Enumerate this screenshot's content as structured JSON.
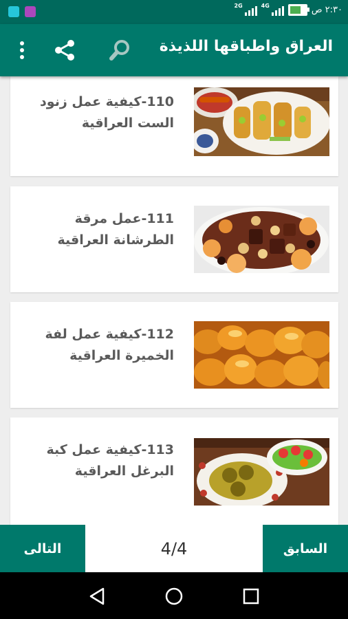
{
  "status_bar": {
    "time": "٢:٣٠ ص",
    "network_1": "2G",
    "network_2": "4G",
    "battery_fraction": 0.75,
    "colors": {
      "notif1": "#26c6da",
      "notif2": "#ab47bc",
      "battery": "#4caf50"
    }
  },
  "app_bar": {
    "title": "العراق واطباقها اللذيذة",
    "icons": [
      "search-icon",
      "share-icon",
      "more-vert-icon"
    ]
  },
  "recipes": [
    {
      "number": "110",
      "title_part1": "كيفية عمل زنود",
      "title_part2": "الست العراقية"
    },
    {
      "number": "111",
      "title_part1": "عمل مرقة",
      "title_part2": "الطرشانة العراقية"
    },
    {
      "number": "112",
      "title_part1": "كيفية عمل لفة",
      "title_part2": "الخميرة العراقية"
    },
    {
      "number": "113",
      "title_part1": "كيفية عمل كبة",
      "title_part2": "البرغل العراقية"
    }
  ],
  "pager": {
    "next_label": "التالى",
    "prev_label": "السابق",
    "indicator": "4/4"
  },
  "colors": {
    "primary": "#00796b",
    "primary_dark": "#00695c",
    "card": "#ffffff",
    "background": "#eeeeee"
  }
}
